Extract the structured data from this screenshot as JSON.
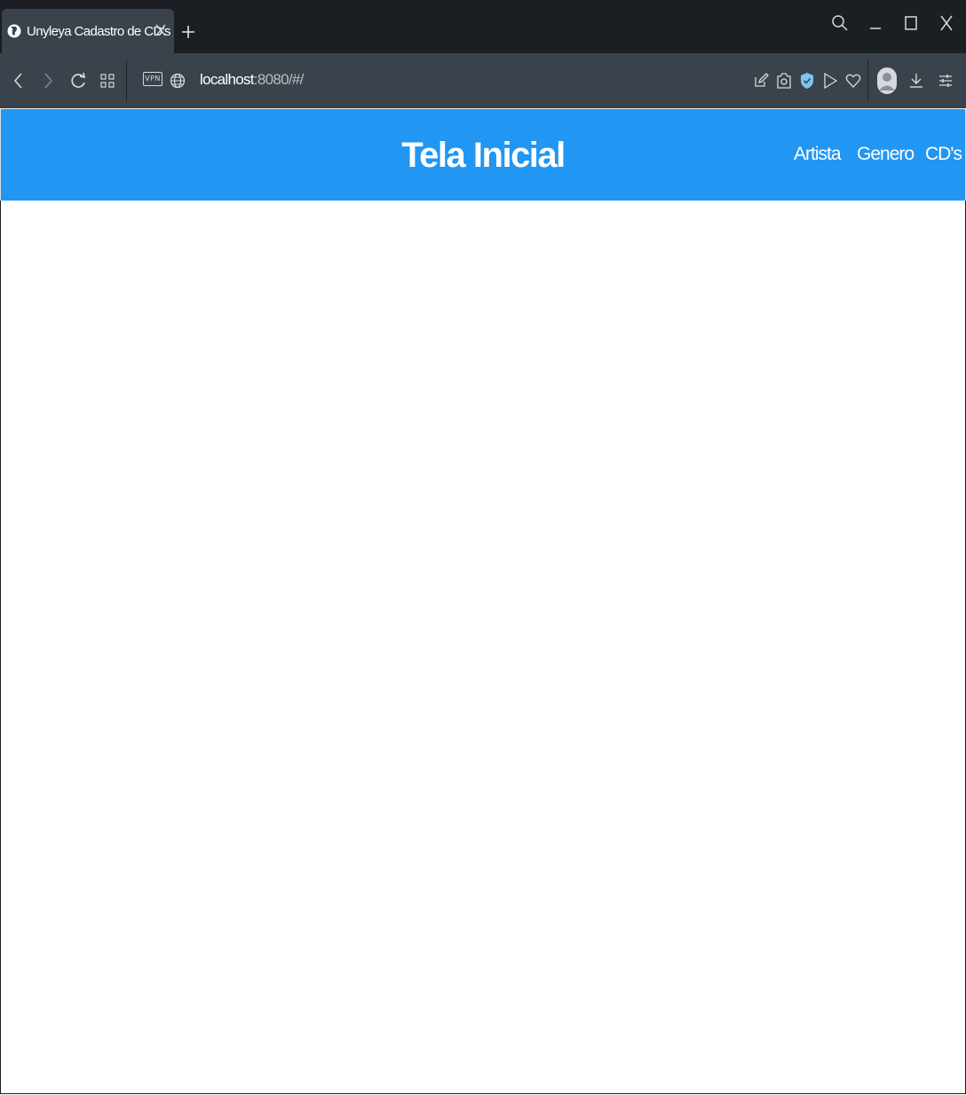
{
  "browser": {
    "tab": {
      "title": "Unyleya Cadastro de CD's",
      "favicon": "globe-icon"
    },
    "address": {
      "host": "localhost",
      "path": ":8080/#/"
    },
    "vpn_label": "VPN"
  },
  "app": {
    "title": "Tela Inicial",
    "nav": [
      {
        "label": "Artista"
      },
      {
        "label": "Genero"
      },
      {
        "label": "CD's"
      }
    ],
    "colors": {
      "appbar": "#2196f3",
      "browser_dark": "#1b1e23",
      "browser_toolbar": "#3a424c"
    }
  }
}
